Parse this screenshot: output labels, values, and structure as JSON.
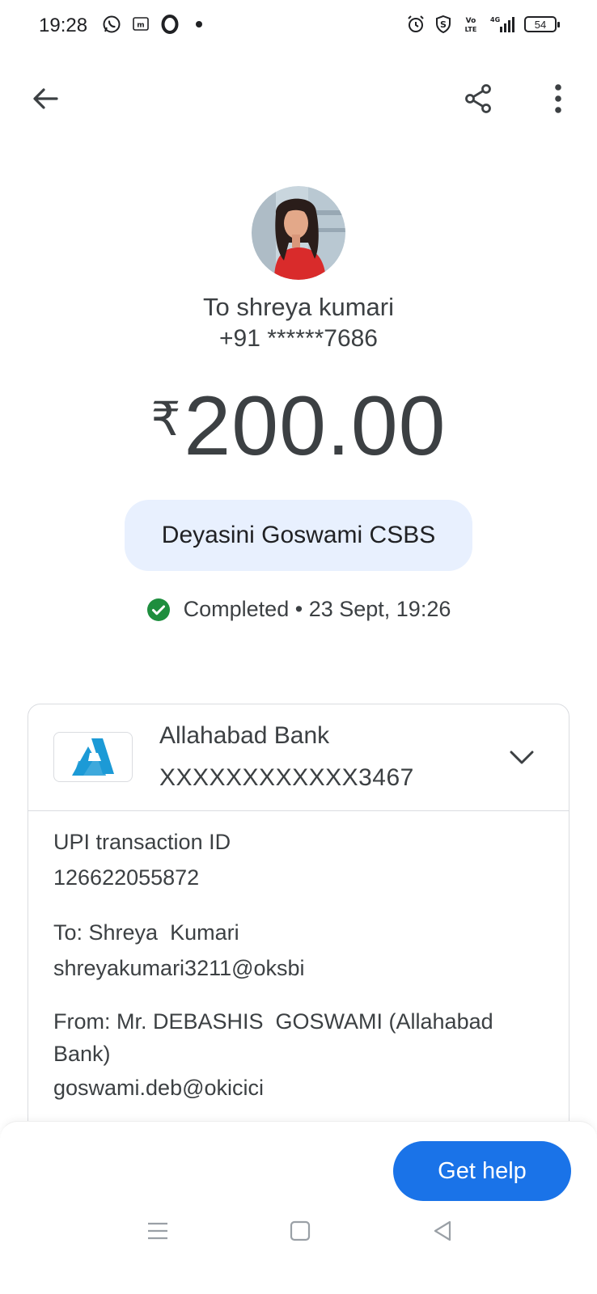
{
  "status_bar": {
    "time": "19:28",
    "battery": "54",
    "network": "4G",
    "left_icons": [
      "whatsapp-icon",
      "message-icon",
      "opera-icon",
      "dot-icon"
    ],
    "right_icons": [
      "alarm-icon",
      "shield-icon",
      "volte-icon",
      "signal-icon",
      "battery-icon"
    ]
  },
  "app_bar": {
    "back_icon": "arrow-left-icon",
    "share_icon": "share-icon",
    "more_icon": "more-vertical-icon"
  },
  "recipient": {
    "title": "To shreya kumari",
    "phone": "+91 ******7686"
  },
  "payment": {
    "currency": "₹",
    "amount": "200.00",
    "note": "Deyasini Goswami CSBS",
    "status": "Completed",
    "separator": "•",
    "datetime": "23 Sept, 19:26"
  },
  "account": {
    "bank_name": "Allahabad Bank",
    "account_number": "XXXXXXXXXXXX3467"
  },
  "details": {
    "txn_label": "UPI transaction ID",
    "txn_id": "126622055872",
    "to_label": "To: Shreya  Kumari",
    "to_upi": "shreyakumari3211@oksbi",
    "from_label": "From: Mr. DEBASHIS  GOSWAMI (Allahabad Bank)",
    "from_upi": "goswami.deb@okicici"
  },
  "actions": {
    "help_label": "Get help"
  },
  "colors": {
    "accent": "#1a73e8",
    "chip_bg": "#e8f0fe",
    "success": "#1e8e3e",
    "bank_logo": "#1c9ad6"
  }
}
